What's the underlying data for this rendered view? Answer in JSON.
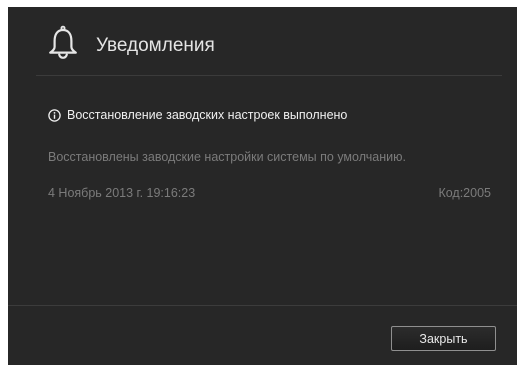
{
  "dialog": {
    "title": "Уведомления",
    "header_icon": "bell-icon",
    "colors": {
      "background": "#272727",
      "title_text": "#e4e4e4",
      "primary_text": "#f0f0f0",
      "secondary_text": "#7b7b7b",
      "divider": "#3b3b3b",
      "button_border": "#8f8f8f"
    }
  },
  "notification": {
    "icon": "info-icon",
    "title": "Восстановление заводских настроек выполнено",
    "body": "Восстановлены заводские настройки системы по умолчанию.",
    "date": "4 Ноябрь 2013 г. 19:16:23",
    "code": "Код:2005"
  },
  "footer": {
    "close_label": "Закрыть"
  }
}
